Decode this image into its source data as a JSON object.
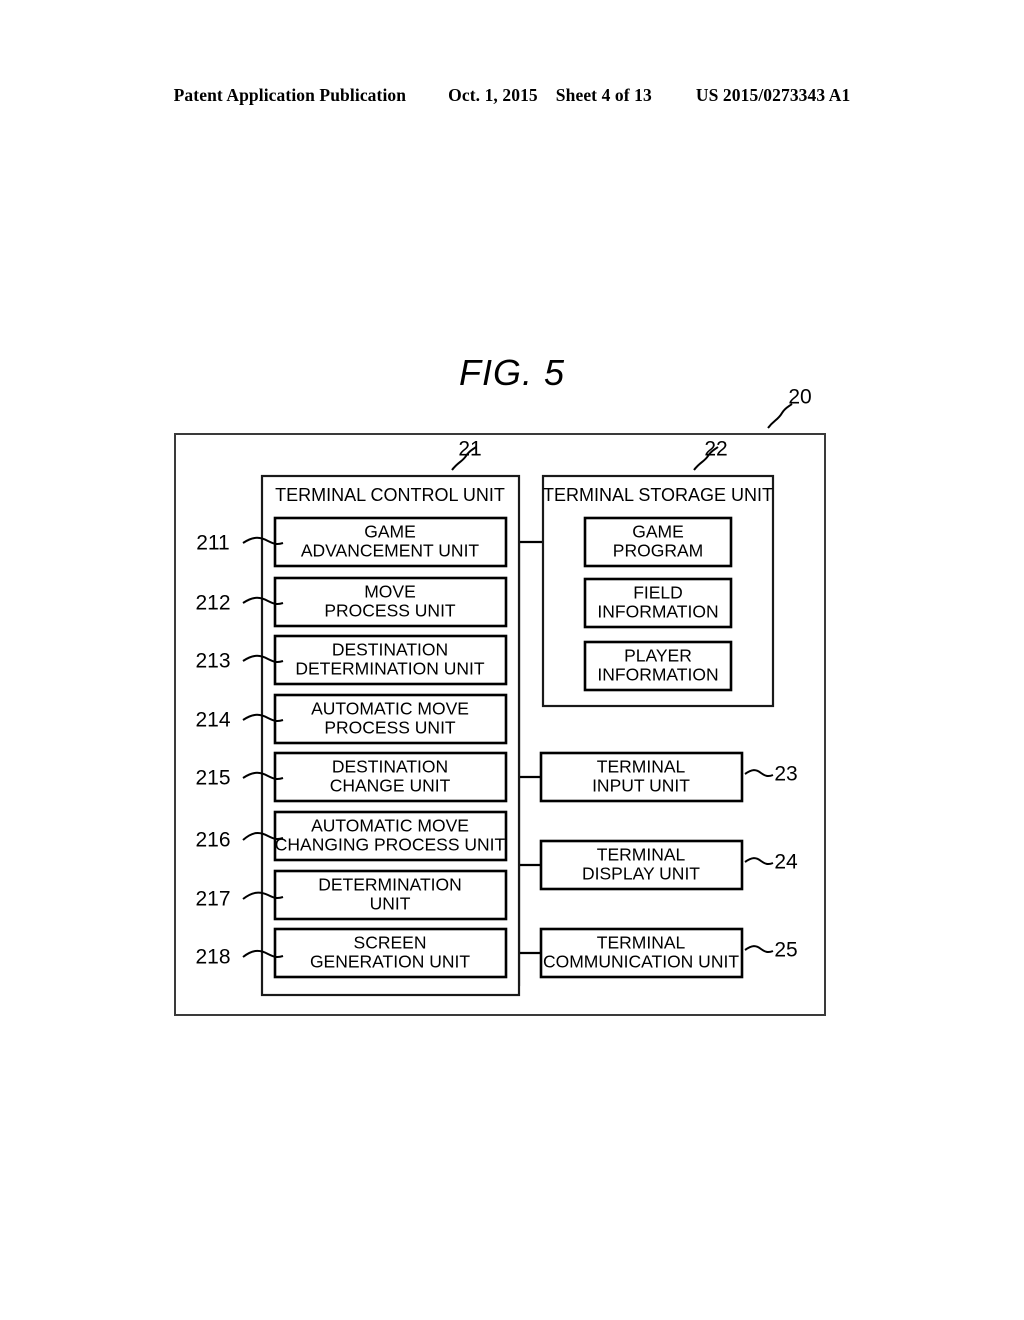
{
  "header": {
    "publication": "Patent Application Publication",
    "date": "Oct. 1, 2015",
    "sheet": "Sheet 4 of 13",
    "patent_number": "US 2015/0273343 A1"
  },
  "figure": {
    "title": "FIG. 5",
    "outer_ref": "20"
  },
  "control_unit": {
    "title": "TERMINAL CONTROL UNIT",
    "ref": "21",
    "items": [
      {
        "ref": "211",
        "line1": "GAME",
        "line2": "ADVANCEMENT UNIT"
      },
      {
        "ref": "212",
        "line1": "MOVE",
        "line2": "PROCESS UNIT"
      },
      {
        "ref": "213",
        "line1": "DESTINATION",
        "line2": "DETERMINATION UNIT"
      },
      {
        "ref": "214",
        "line1": "AUTOMATIC MOVE",
        "line2": "PROCESS UNIT"
      },
      {
        "ref": "215",
        "line1": "DESTINATION",
        "line2": "CHANGE UNIT"
      },
      {
        "ref": "216",
        "line1": "AUTOMATIC MOVE",
        "line2": "CHANGING PROCESS UNIT"
      },
      {
        "ref": "217",
        "line1": "DETERMINATION",
        "line2": "UNIT"
      },
      {
        "ref": "218",
        "line1": "SCREEN",
        "line2": "GENERATION UNIT"
      }
    ]
  },
  "storage_unit": {
    "title": "TERMINAL STORAGE UNIT",
    "ref": "22",
    "items": [
      {
        "line1": "GAME",
        "line2": "PROGRAM"
      },
      {
        "line1": "FIELD",
        "line2": "INFORMATION"
      },
      {
        "line1": "PLAYER",
        "line2": "INFORMATION"
      }
    ]
  },
  "peripherals": [
    {
      "ref": "23",
      "line1": "TERMINAL",
      "line2": "INPUT UNIT"
    },
    {
      "ref": "24",
      "line1": "TERMINAL",
      "line2": "DISPLAY UNIT"
    },
    {
      "ref": "25",
      "line1": "TERMINAL",
      "line2": "COMMUNICATION UNIT"
    }
  ],
  "colors": {
    "line": "#000000",
    "outer_line": "#3a3a3a",
    "background": "#ffffff"
  }
}
